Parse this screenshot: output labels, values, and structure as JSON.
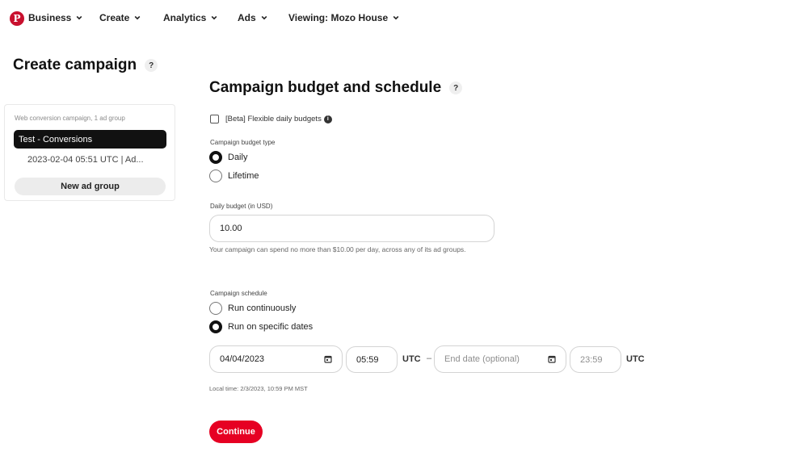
{
  "nav": {
    "logo": "pinterest-logo",
    "items": [
      {
        "label": "Business",
        "icon": "chevron-down-icon"
      },
      {
        "label": "Create",
        "icon": "chevron-down-icon"
      },
      {
        "label": "Analytics",
        "icon": "chevron-down-icon"
      },
      {
        "label": "Ads",
        "icon": "chevron-down-icon"
      },
      {
        "label": "Viewing: Mozo House",
        "icon": "chevron-down-icon"
      }
    ]
  },
  "sidebar": {
    "title": "Create campaign",
    "help": "?",
    "caption": "Web conversion campaign, 1 ad group",
    "campaign_name": "Test - Conversions",
    "ad_group": "2023-02-04 05:51 UTC | Ad...",
    "new_ad_group_label": "New ad group"
  },
  "form": {
    "title": "Campaign budget and schedule",
    "help": "?",
    "flexible_budget": {
      "label": "[Beta] Flexible daily budgets",
      "checked": false,
      "info": "i"
    },
    "budget_type": {
      "label": "Campaign budget type",
      "options": [
        {
          "label": "Daily",
          "selected": true
        },
        {
          "label": "Lifetime",
          "selected": false
        }
      ]
    },
    "daily_budget": {
      "label": "Daily budget (in USD)",
      "value": "10.00",
      "helper": "Your campaign can spend no more than $10.00 per day, across any of its ad groups."
    },
    "schedule": {
      "label": "Campaign schedule",
      "options": [
        {
          "label": "Run continuously",
          "selected": false
        },
        {
          "label": "Run on specific dates",
          "selected": true
        }
      ],
      "start_date": "04/04/2023",
      "start_time": "05:59",
      "start_tz": "UTC",
      "separator": "–",
      "end_date_placeholder": "End date (optional)",
      "end_time": "23:59",
      "end_tz": "UTC",
      "local_time": "Local time: 2/3/2023, 10:59 PM MST"
    },
    "continue_label": "Continue"
  },
  "colors": {
    "brand": "#e60023",
    "selected_bg": "#111111"
  }
}
